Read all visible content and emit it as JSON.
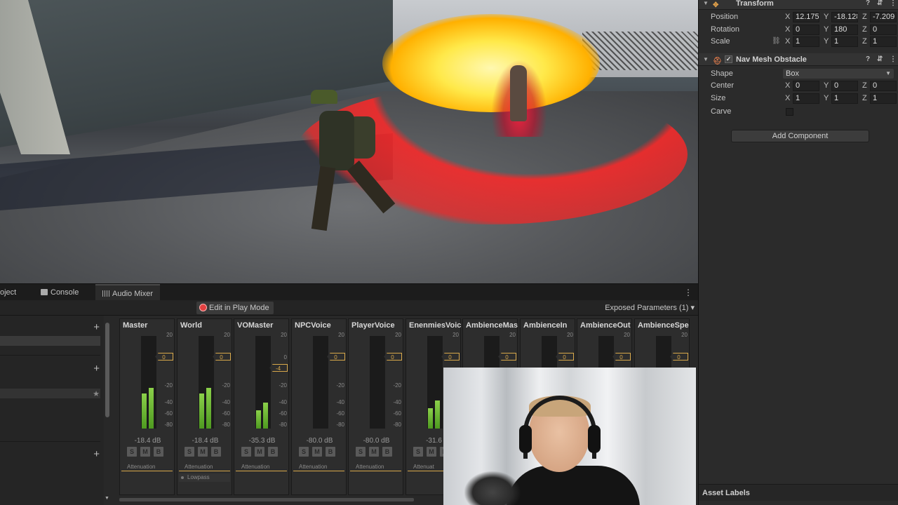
{
  "bottom": {
    "tabs": [
      {
        "label": "oject"
      },
      {
        "label": "Console"
      },
      {
        "label": "Audio Mixer"
      }
    ],
    "kebab": "⋮",
    "edit_play_label": "Edit in Play Mode",
    "exposed_label": "Exposed Parameters (1) ▾",
    "plus": "+",
    "star": "★"
  },
  "mixer": {
    "scale_labels": [
      "20",
      "0",
      "-20",
      "-40",
      "-60",
      "-80"
    ],
    "smb": [
      "S",
      "M",
      "B"
    ],
    "strips": [
      {
        "name": "Master",
        "db": "-18.4 dB",
        "fader": "0",
        "level_l": 0.38,
        "level_r": 0.44,
        "effects": [
          "Attenuation"
        ]
      },
      {
        "name": "World",
        "db": "-18.4 dB",
        "fader": "0",
        "level_l": 0.38,
        "level_r": 0.44,
        "effects": [
          "Attenuation",
          "Lowpass"
        ]
      },
      {
        "name": "VOMaster",
        "db": "-35.3 dB",
        "fader": "-4",
        "level_l": 0.2,
        "level_r": 0.28,
        "effects": [
          "Attenuation"
        ]
      },
      {
        "name": "NPCVoice",
        "db": "-80.0 dB",
        "fader": "0",
        "level_l": 0.0,
        "level_r": 0.0,
        "effects": [
          "Attenuation"
        ]
      },
      {
        "name": "PlayerVoice",
        "db": "-80.0 dB",
        "fader": "0",
        "level_l": 0.0,
        "level_r": 0.0,
        "effects": [
          "Attenuation"
        ]
      },
      {
        "name": "EnenmiesVoic",
        "db": "-31.6",
        "fader": "0",
        "level_l": 0.22,
        "level_r": 0.3,
        "effects": [
          "Attenuat"
        ]
      },
      {
        "name": "AmbienceMas",
        "db": "",
        "fader": "0",
        "level_l": 0.0,
        "level_r": 0.0,
        "effects": []
      },
      {
        "name": "AmbienceIn",
        "db": "",
        "fader": "0",
        "level_l": 0.0,
        "level_r": 0.0,
        "effects": []
      },
      {
        "name": "AmbienceOut",
        "db": "",
        "fader": "0",
        "level_l": 0.0,
        "level_r": 0.0,
        "effects": []
      },
      {
        "name": "AmbienceSpe",
        "db": "",
        "fader": "0",
        "level_l": 0.0,
        "level_r": 0.0,
        "effects": []
      }
    ]
  },
  "inspector": {
    "transform": {
      "title": "Transform",
      "position_label": "Position",
      "rotation_label": "Rotation",
      "scale_label": "Scale",
      "position": {
        "x": "12.175",
        "y": "-18.128",
        "z": "-7.209"
      },
      "rotation": {
        "x": "0",
        "y": "180",
        "z": "0"
      },
      "scale": {
        "x": "1",
        "y": "1",
        "z": "1"
      }
    },
    "nav": {
      "title": "Nav Mesh Obstacle",
      "check": "✓",
      "shape_label": "Shape",
      "shape_value": "Box",
      "center_label": "Center",
      "center": {
        "x": "0",
        "y": "0",
        "z": "0"
      },
      "size_label": "Size",
      "size": {
        "x": "1",
        "y": "1",
        "z": "1"
      },
      "carve_label": "Carve"
    },
    "axes": {
      "x": "X",
      "y": "Y",
      "z": "Z"
    },
    "add_component": "Add Component",
    "asset_labels": "Asset Labels",
    "help_icon": "?",
    "settings_icon": "⇵",
    "menu_icon": "⋮",
    "link_icon": "⛓"
  }
}
